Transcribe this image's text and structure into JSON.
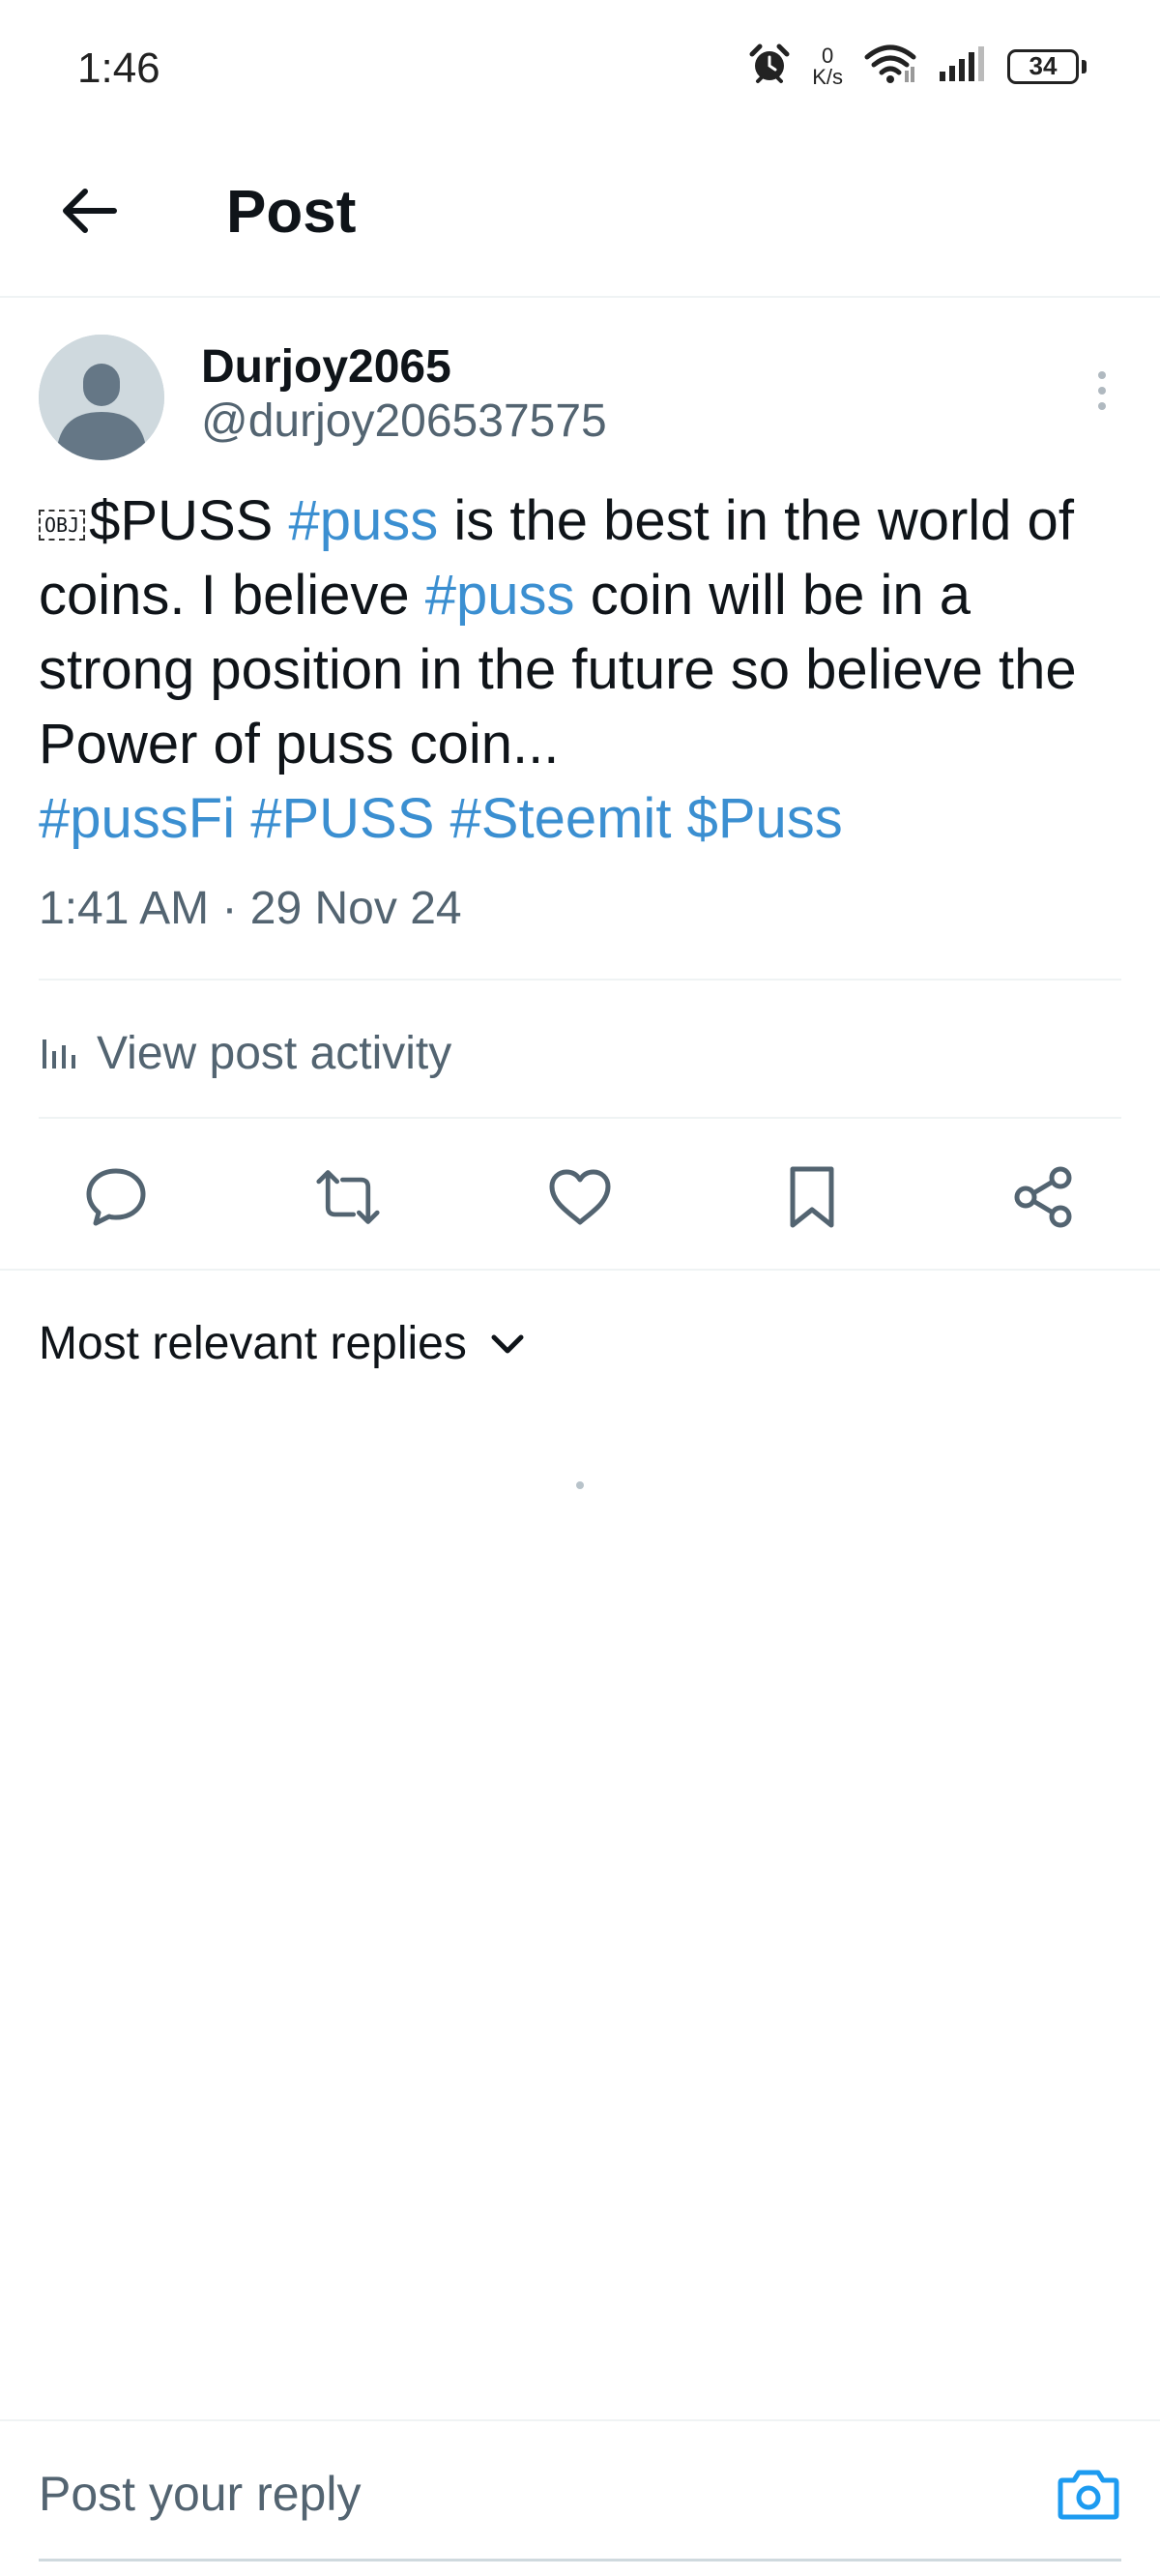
{
  "status_bar": {
    "time": "1:46",
    "net_speed_value": "0",
    "net_speed_unit": "K/s",
    "battery": "34",
    "icons": [
      "alarm-icon",
      "wifi-icon",
      "signal-icon",
      "battery-icon"
    ]
  },
  "header": {
    "title": "Post",
    "back_icon": "back-arrow-icon"
  },
  "post": {
    "author": {
      "display_name": "Durjoy2065",
      "handle": "@durjoy206537575"
    },
    "text": {
      "obj_marker": "OBJ",
      "cashtag_1": "$PUSS",
      "hashtag_1": "#puss",
      "part_1": "is the best in the world of coins. I believe",
      "hashtag_2": "#puss",
      "part_2": "coin will be in a strong position in the future so believe the Power of puss coin...",
      "tags": [
        "#pussFi",
        "#PUSS",
        "#Steemit",
        "$Puss"
      ]
    },
    "timestamp": "1:41 AM · 29 Nov 24",
    "activity_label": "View post activity",
    "actions": [
      "reply-icon",
      "repost-icon",
      "like-icon",
      "bookmark-icon",
      "share-icon"
    ]
  },
  "replies": {
    "sort_label": "Most relevant replies"
  },
  "composer": {
    "placeholder": "Post your reply"
  },
  "colors": {
    "link": "#3b8fd1",
    "secondary_text": "#536471",
    "primary_text": "#0f1419",
    "divider": "#eff3f4"
  }
}
